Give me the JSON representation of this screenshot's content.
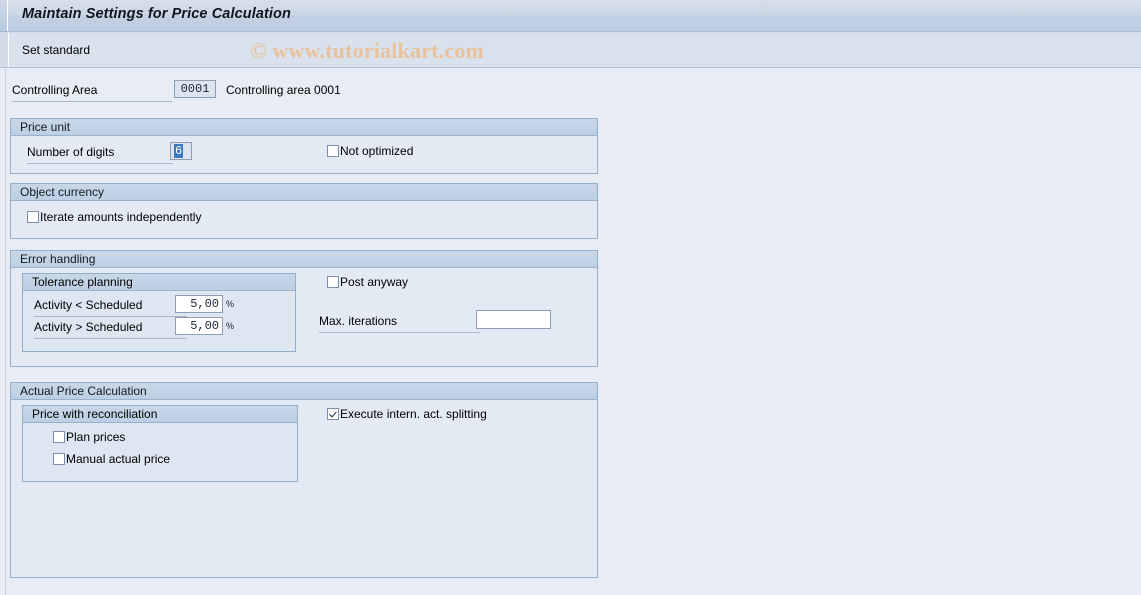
{
  "window": {
    "title": "Maintain Settings for Price Calculation"
  },
  "toolbar": {
    "set_standard_label": "Set standard"
  },
  "watermark": {
    "text": "© www.tutorialkart.com",
    "color": "#e8c29a"
  },
  "header_row": {
    "controlling_area_label": "Controlling Area",
    "controlling_area_value": "0001",
    "controlling_area_description": "Controlling area 0001"
  },
  "price_unit": {
    "title": "Price unit",
    "number_of_digits_label": "Number of digits",
    "number_of_digits_value": "6",
    "not_optimized_label": "Not optimized",
    "not_optimized_checked": false
  },
  "object_currency": {
    "title": "Object currency",
    "iterate_label": "Iterate amounts independently",
    "iterate_checked": false
  },
  "error_handling": {
    "title": "Error handling",
    "tolerance_planning": {
      "title": "Tolerance planning",
      "rows": [
        {
          "label": "Activity < Scheduled",
          "value": "5,00",
          "unit": "%"
        },
        {
          "label": "Activity > Scheduled",
          "value": "5,00",
          "unit": "%"
        }
      ]
    },
    "post_anyway_label": "Post anyway",
    "post_anyway_checked": false,
    "max_iterations_label": "Max. iterations",
    "max_iterations_value": ""
  },
  "actual_price_calculation": {
    "title": "Actual Price Calculation",
    "price_with_reconciliation": {
      "title": "Price with reconciliation",
      "options": [
        {
          "label": "Plan prices",
          "checked": false
        },
        {
          "label": "Manual actual price",
          "checked": false
        }
      ]
    },
    "execute_splitting_label": "Execute intern. act. splitting",
    "execute_splitting_checked": true
  },
  "colors": {
    "background": "#e8edf5",
    "title_bar": "#c2d0e2",
    "group_border": "#93aec9",
    "accent_selection": "#3b78c3"
  }
}
